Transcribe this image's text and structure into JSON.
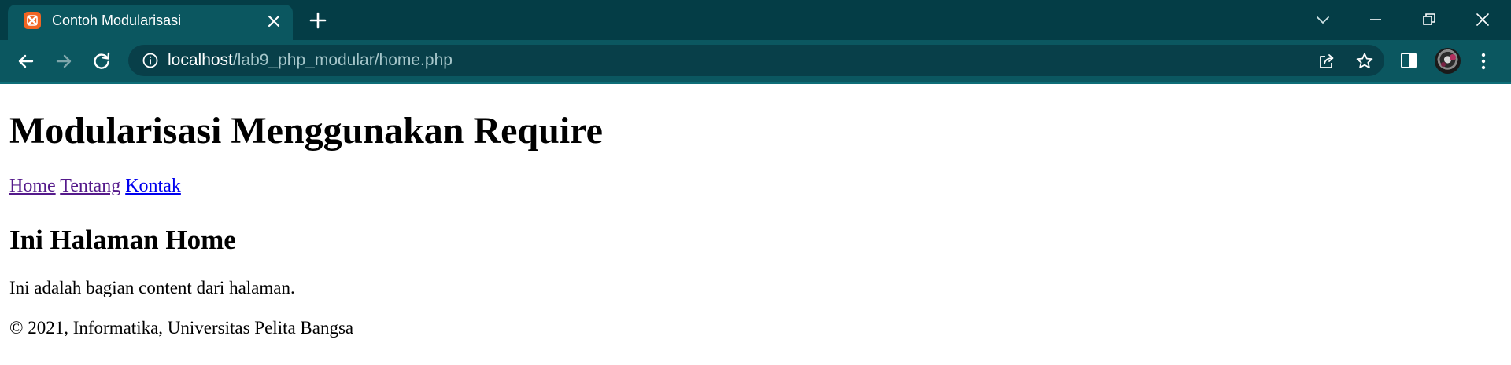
{
  "browser": {
    "tab": {
      "title": "Contoh Modularisasi",
      "favicon": "xampp-icon"
    },
    "toolbar": {
      "url_host": "localhost",
      "url_path": "/lab9_php_modular/home.php"
    },
    "colors": {
      "tabstrip": "#043d46",
      "toolbar": "#0b5760",
      "omnibox": "#083f49",
      "favicon": "#f26522"
    }
  },
  "page": {
    "heading": "Modularisasi Menggunakan Require",
    "nav": [
      {
        "label": "Home"
      },
      {
        "label": "Tentang"
      },
      {
        "label": "Kontak"
      }
    ],
    "subheading": "Ini Halaman Home",
    "content": "Ini adalah bagian content dari halaman.",
    "footer": "© 2021, Informatika, Universitas Pelita Bangsa",
    "colors": {
      "link_visited": "#551a8b",
      "link_unvisited": "#0000ee"
    }
  }
}
